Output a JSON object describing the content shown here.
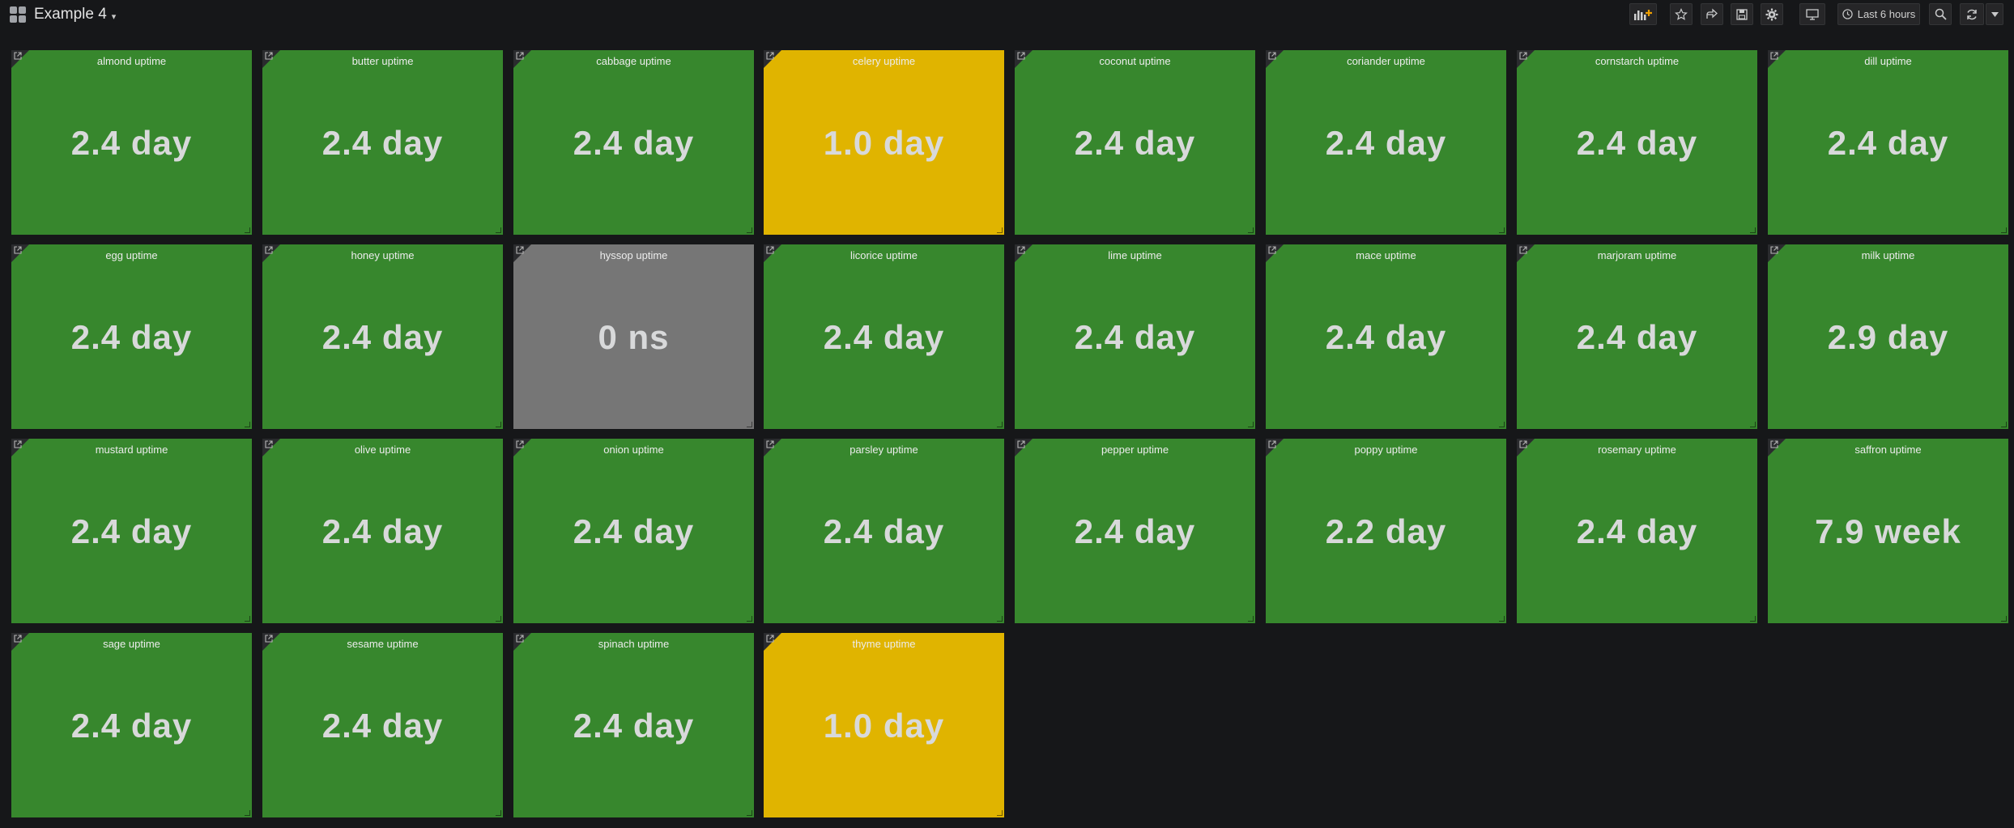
{
  "dashboard": {
    "title": "Example 4"
  },
  "toolbar": {
    "time_range": "Last 6 hours"
  },
  "colors": {
    "ok": "#37872d",
    "warning": "#e0b400",
    "no_data": "#767676",
    "background": "#161719"
  },
  "icons": [
    "dashboard-grid-icon",
    "add-panel-icon",
    "star-icon",
    "share-icon",
    "save-icon",
    "settings-gear-icon",
    "tv-mode-icon",
    "clock-icon",
    "zoom-out-icon",
    "refresh-icon",
    "chevron-down-icon",
    "external-link-icon"
  ],
  "panels": [
    {
      "title": "almond uptime",
      "value": "2.4 day",
      "status": "ok"
    },
    {
      "title": "butter uptime",
      "value": "2.4 day",
      "status": "ok"
    },
    {
      "title": "cabbage uptime",
      "value": "2.4 day",
      "status": "ok"
    },
    {
      "title": "celery uptime",
      "value": "1.0 day",
      "status": "warning"
    },
    {
      "title": "coconut uptime",
      "value": "2.4 day",
      "status": "ok"
    },
    {
      "title": "coriander uptime",
      "value": "2.4 day",
      "status": "ok"
    },
    {
      "title": "cornstarch uptime",
      "value": "2.4 day",
      "status": "ok"
    },
    {
      "title": "dill uptime",
      "value": "2.4 day",
      "status": "ok"
    },
    {
      "title": "egg uptime",
      "value": "2.4 day",
      "status": "ok"
    },
    {
      "title": "honey uptime",
      "value": "2.4 day",
      "status": "ok"
    },
    {
      "title": "hyssop uptime",
      "value": "0 ns",
      "status": "nodata"
    },
    {
      "title": "licorice uptime",
      "value": "2.4 day",
      "status": "ok"
    },
    {
      "title": "lime uptime",
      "value": "2.4 day",
      "status": "ok"
    },
    {
      "title": "mace uptime",
      "value": "2.4 day",
      "status": "ok"
    },
    {
      "title": "marjoram uptime",
      "value": "2.4 day",
      "status": "ok"
    },
    {
      "title": "milk uptime",
      "value": "2.9 day",
      "status": "ok"
    },
    {
      "title": "mustard uptime",
      "value": "2.4 day",
      "status": "ok"
    },
    {
      "title": "olive uptime",
      "value": "2.4 day",
      "status": "ok"
    },
    {
      "title": "onion uptime",
      "value": "2.4 day",
      "status": "ok"
    },
    {
      "title": "parsley uptime",
      "value": "2.4 day",
      "status": "ok"
    },
    {
      "title": "pepper uptime",
      "value": "2.4 day",
      "status": "ok"
    },
    {
      "title": "poppy uptime",
      "value": "2.2 day",
      "status": "ok"
    },
    {
      "title": "rosemary uptime",
      "value": "2.4 day",
      "status": "ok"
    },
    {
      "title": "saffron uptime",
      "value": "7.9 week",
      "status": "ok"
    },
    {
      "title": "sage uptime",
      "value": "2.4 day",
      "status": "ok"
    },
    {
      "title": "sesame uptime",
      "value": "2.4 day",
      "status": "ok"
    },
    {
      "title": "spinach uptime",
      "value": "2.4 day",
      "status": "ok"
    },
    {
      "title": "thyme uptime",
      "value": "1.0 day",
      "status": "warning"
    }
  ]
}
